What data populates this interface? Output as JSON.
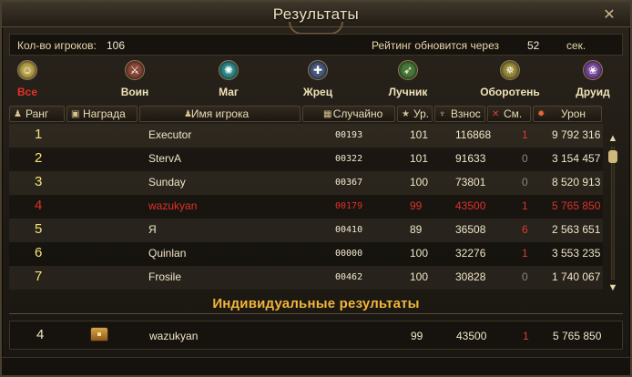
{
  "window": {
    "title": "Результаты",
    "close_label": "✕"
  },
  "info": {
    "players_label": "Кол-во игроков:",
    "players_count": "106",
    "refresh_label": "Рейтинг обновится через",
    "refresh_value": "52",
    "refresh_unit": "сек."
  },
  "classes": [
    {
      "label": "Все",
      "icon": "smiley-icon",
      "color": "#b8a24a",
      "active": true
    },
    {
      "label": "Воин",
      "icon": "warrior-icon",
      "color": "#8a4a3a"
    },
    {
      "label": "Маг",
      "icon": "mage-icon",
      "color": "#2f8a8a"
    },
    {
      "label": "Жрец",
      "icon": "priest-icon",
      "color": "#4a5a7a"
    },
    {
      "label": "Лучник",
      "icon": "archer-icon",
      "color": "#4a7a3a"
    },
    {
      "label": "Оборотень",
      "icon": "werewolf-icon",
      "color": "#9a8a3a"
    },
    {
      "label": "Друид",
      "icon": "druid-icon",
      "color": "#7a4a9a"
    }
  ],
  "columns": {
    "rank": "Ранг",
    "reward": "Награда",
    "name": "Имя игрока",
    "random": "Случайно",
    "level": "Ур.",
    "score": "Взнос",
    "kills": "См.",
    "damage": "Урон"
  },
  "rows": [
    {
      "rank": "1",
      "name": "Executor",
      "random": "00193",
      "level": "101",
      "score": "116868",
      "kills": "1",
      "damage": "9 792 316"
    },
    {
      "rank": "2",
      "name": "StervA",
      "random": "00322",
      "level": "101",
      "score": "91633",
      "kills": "0",
      "damage": "3 154 457"
    },
    {
      "rank": "3",
      "name": "Sunday",
      "random": "00367",
      "level": "100",
      "score": "73801",
      "kills": "0",
      "damage": "8 520 913"
    },
    {
      "rank": "4",
      "name": "wazukyan",
      "random": "00179",
      "level": "99",
      "score": "43500",
      "kills": "1",
      "damage": "5 765 850",
      "me": true
    },
    {
      "rank": "5",
      "name": "Я",
      "random": "00410",
      "level": "89",
      "score": "36508",
      "kills": "6",
      "damage": "2 563 651"
    },
    {
      "rank": "6",
      "name": "Quinlan",
      "random": "00000",
      "level": "100",
      "score": "32276",
      "kills": "1",
      "damage": "3 553 235"
    },
    {
      "rank": "7",
      "name": "Frosile",
      "random": "00462",
      "level": "100",
      "score": "30828",
      "kills": "0",
      "damage": "1 740 067"
    }
  ],
  "individual": {
    "title": "Индивидуальные результаты",
    "rank": "4",
    "name": "wazukyan",
    "level": "99",
    "score": "43500",
    "kills": "1",
    "damage": "5 765 850"
  },
  "colors": {
    "accent": "#e0302a",
    "gold": "#f2b63a",
    "rank_gold": "#f3e27a"
  }
}
